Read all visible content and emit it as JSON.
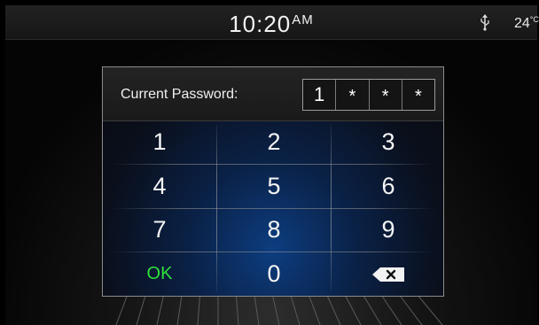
{
  "status_bar": {
    "time": "10:20",
    "ampm": "AM",
    "usb_icon": "usb-icon",
    "temperature": "24",
    "temperature_unit": "°C"
  },
  "password_dialog": {
    "label": "Current Password:",
    "entered": [
      "1",
      "*",
      "*",
      "*"
    ]
  },
  "keypad": {
    "keys": [
      "1",
      "2",
      "3",
      "4",
      "5",
      "6",
      "7",
      "8",
      "9",
      "OK",
      "0"
    ],
    "backspace_icon": "backspace-icon",
    "ok_color": "#2fdf3a"
  }
}
